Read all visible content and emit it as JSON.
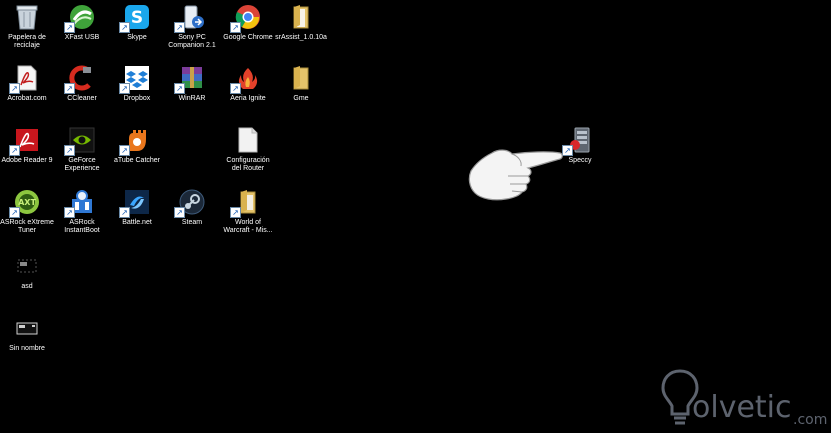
{
  "desktop": {
    "icons": {
      "recycle_bin": "Papelera de\nreciclaje",
      "xfast_usb": "XFast USB",
      "skype": "Skype",
      "sony_pc": "Sony PC\nCompanion 2.1",
      "google_chrome": "Google Chrome",
      "srassist": "srAssist_1.0.10a",
      "acrobat": "Acrobat.com",
      "ccleaner": "CCleaner",
      "dropbox": "Dropbox",
      "winrar": "WinRAR",
      "aeria": "Aeria Ignite",
      "gme": "Gme",
      "adobe_reader": "Adobe Reader 9",
      "geforce": "GeForce\nExperience",
      "atube": "aTube Catcher",
      "config_router": "Configuración\ndel Router",
      "speccy": "Speccy",
      "asrock_tuner": "ASRock eXtreme\nTuner",
      "asrock_instantboot": "ASRock\nInstantBoot",
      "battlenet": "Battle.net",
      "steam": "Steam",
      "wow": "World of\nWarcraft - Mis...",
      "asd": "asd",
      "sin_nombre": "Sin nombre"
    }
  },
  "watermark": {
    "brand": "olvetic",
    "domain": ".com"
  },
  "colors": {
    "background": "#000000",
    "label": "#ffffff"
  }
}
